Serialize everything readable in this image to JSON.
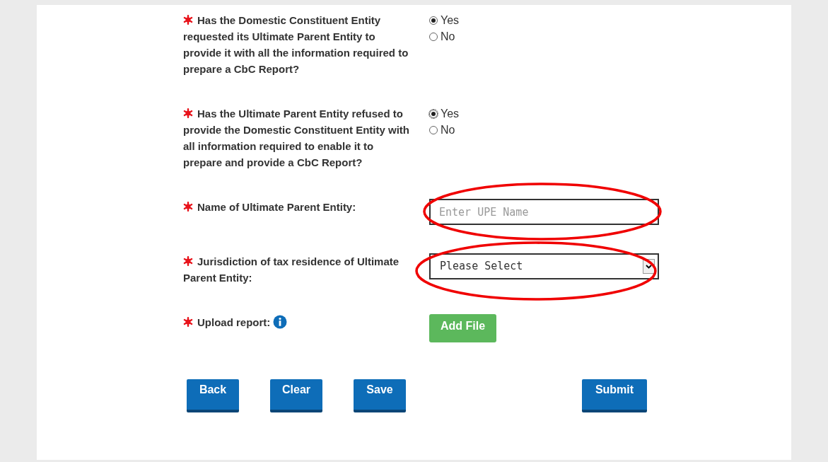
{
  "questions": [
    {
      "kind": "radio",
      "label": "Has the Domestic Constituent Entity requested its Ultimate Parent Entity to provide it with all the information required to prepare a CbC Report?",
      "options": [
        {
          "label": "Yes",
          "selected": true
        },
        {
          "label": "No",
          "selected": false
        }
      ]
    },
    {
      "kind": "radio",
      "label": "Has the Ultimate Parent Entity refused to provide the Domestic Constituent Entity with all information required to enable it to prepare and provide a CbC Report?",
      "options": [
        {
          "label": "Yes",
          "selected": true
        },
        {
          "label": "No",
          "selected": false
        }
      ]
    },
    {
      "kind": "text",
      "label": "Name of Ultimate Parent Entity:",
      "placeholder": "Enter UPE Name"
    },
    {
      "kind": "select",
      "label": "Jurisdiction of tax residence of Ultimate Parent Entity:",
      "value": "Please Select"
    },
    {
      "kind": "upload",
      "label": "Upload report:",
      "button": "Add File"
    }
  ],
  "buttons": [
    {
      "label": "Back",
      "kind": "nav"
    },
    {
      "label": "Clear",
      "kind": "nav"
    },
    {
      "label": "Save",
      "kind": "nav"
    },
    {
      "label": "Submit",
      "kind": "submit"
    }
  ]
}
